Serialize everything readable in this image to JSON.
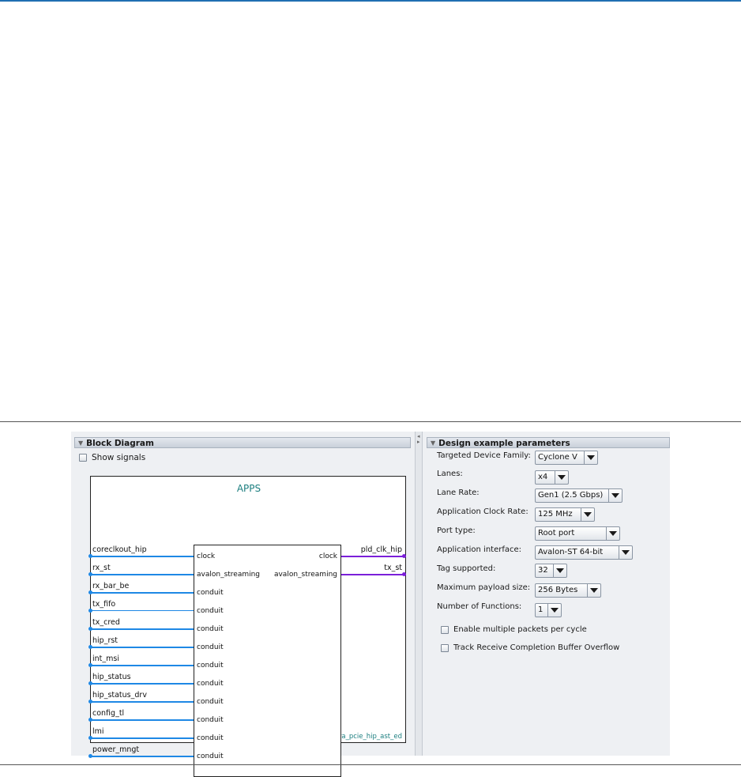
{
  "block_diagram": {
    "header": "Block Diagram",
    "show_signals_label": "Show signals",
    "component_title": "APPS",
    "instance_name": "altera_pcie_hip_ast_ed",
    "left_signals": [
      "coreclkout_hip",
      "rx_st",
      "rx_bar_be",
      "tx_fifo",
      "tx_cred",
      "hip_rst",
      "int_msi",
      "hip_status",
      "hip_status_drv",
      "config_tl",
      "lmi",
      "power_mngt"
    ],
    "left_ports": [
      "clock",
      "avalon_streaming",
      "conduit",
      "conduit",
      "conduit",
      "conduit",
      "conduit",
      "conduit",
      "conduit",
      "conduit",
      "conduit",
      "conduit"
    ],
    "right_signals": [
      "pld_clk_hip",
      "tx_st"
    ],
    "right_ports": [
      "clock",
      "avalon_streaming"
    ],
    "colors": {
      "wire_in": "#1e88e5",
      "wire_out": "#7b1fd9",
      "title": "#1d7f80"
    }
  },
  "design_params": {
    "header": "Design example parameters",
    "fields": [
      {
        "label": "Targeted Device Family:",
        "value": "Cyclone V"
      },
      {
        "label": "Lanes:",
        "value": "x4"
      },
      {
        "label": "Lane Rate:",
        "value": "Gen1 (2.5 Gbps)"
      },
      {
        "label": "Application Clock Rate:",
        "value": "125 MHz"
      },
      {
        "label": "Port type:",
        "value": "Root port"
      },
      {
        "label": "Application interface:",
        "value": "Avalon-ST 64-bit"
      },
      {
        "label": "Tag supported:",
        "value": "32"
      },
      {
        "label": "Maximum payload size:",
        "value": "256 Bytes"
      },
      {
        "label": "Number of Functions:",
        "value": "1"
      }
    ],
    "checkboxes": [
      {
        "label": "Enable multiple packets per cycle",
        "checked": false
      },
      {
        "label": "Track Receive Completion Buffer Overflow",
        "checked": false
      }
    ]
  }
}
